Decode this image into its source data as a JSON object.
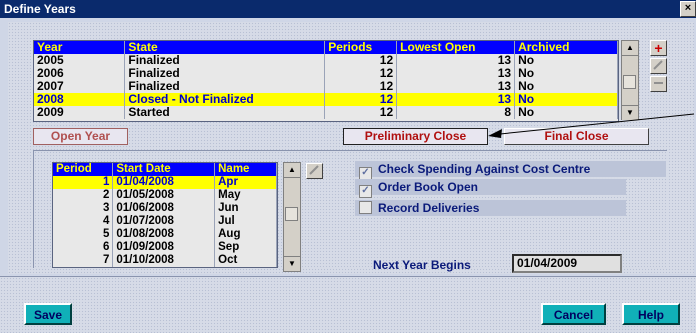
{
  "window": {
    "title": "Define Years",
    "close_glyph": "×"
  },
  "years": {
    "columns": [
      "Year",
      "State",
      "Periods",
      "Lowest Open",
      "Archived"
    ],
    "rows": [
      {
        "year": "2005",
        "state": "Finalized",
        "periods": "12",
        "lowest_open": "13",
        "archived": "No",
        "selected": false
      },
      {
        "year": "2006",
        "state": "Finalized",
        "periods": "12",
        "lowest_open": "13",
        "archived": "No",
        "selected": false
      },
      {
        "year": "2007",
        "state": "Finalized",
        "periods": "12",
        "lowest_open": "13",
        "archived": "No",
        "selected": false
      },
      {
        "year": "2008",
        "state": "Closed - Not Finalized",
        "periods": "12",
        "lowest_open": "13",
        "archived": "No",
        "selected": true
      },
      {
        "year": "2009",
        "state": "Started",
        "periods": "12",
        "lowest_open": "8",
        "archived": "No",
        "selected": false
      }
    ]
  },
  "buttons": {
    "open_year": "Open Year",
    "preliminary_close": "Preliminary Close",
    "final_close": "Final Close",
    "save": "Save",
    "cancel": "Cancel",
    "help": "Help",
    "add_glyph": "+"
  },
  "periods": {
    "columns": [
      "Period",
      "Start Date",
      "Name"
    ],
    "rows": [
      {
        "period": "1",
        "start_date": "01/04/2008",
        "name": "Apr",
        "selected": true
      },
      {
        "period": "2",
        "start_date": "01/05/2008",
        "name": "May",
        "selected": false
      },
      {
        "period": "3",
        "start_date": "01/06/2008",
        "name": "Jun",
        "selected": false
      },
      {
        "period": "4",
        "start_date": "01/07/2008",
        "name": "Jul",
        "selected": false
      },
      {
        "period": "5",
        "start_date": "01/08/2008",
        "name": "Aug",
        "selected": false
      },
      {
        "period": "6",
        "start_date": "01/09/2008",
        "name": "Sep",
        "selected": false
      },
      {
        "period": "7",
        "start_date": "01/10/2008",
        "name": "Oct",
        "selected": false
      }
    ]
  },
  "options": {
    "check_spending": {
      "label": "Check Spending Against Cost Centre",
      "checked": true
    },
    "order_book_open": {
      "label": "Order Book Open",
      "checked": true
    },
    "record_deliveries": {
      "label": "Record Deliveries",
      "checked": false
    }
  },
  "next_year": {
    "label": "Next Year Begins",
    "value": "01/04/2009"
  },
  "colors": {
    "header_bg": "#0000ff",
    "header_text": "#ffff00",
    "selected_bg": "#ffff00",
    "title_bg": "#0a2a6c",
    "accent_teal": "#10b0b8"
  }
}
